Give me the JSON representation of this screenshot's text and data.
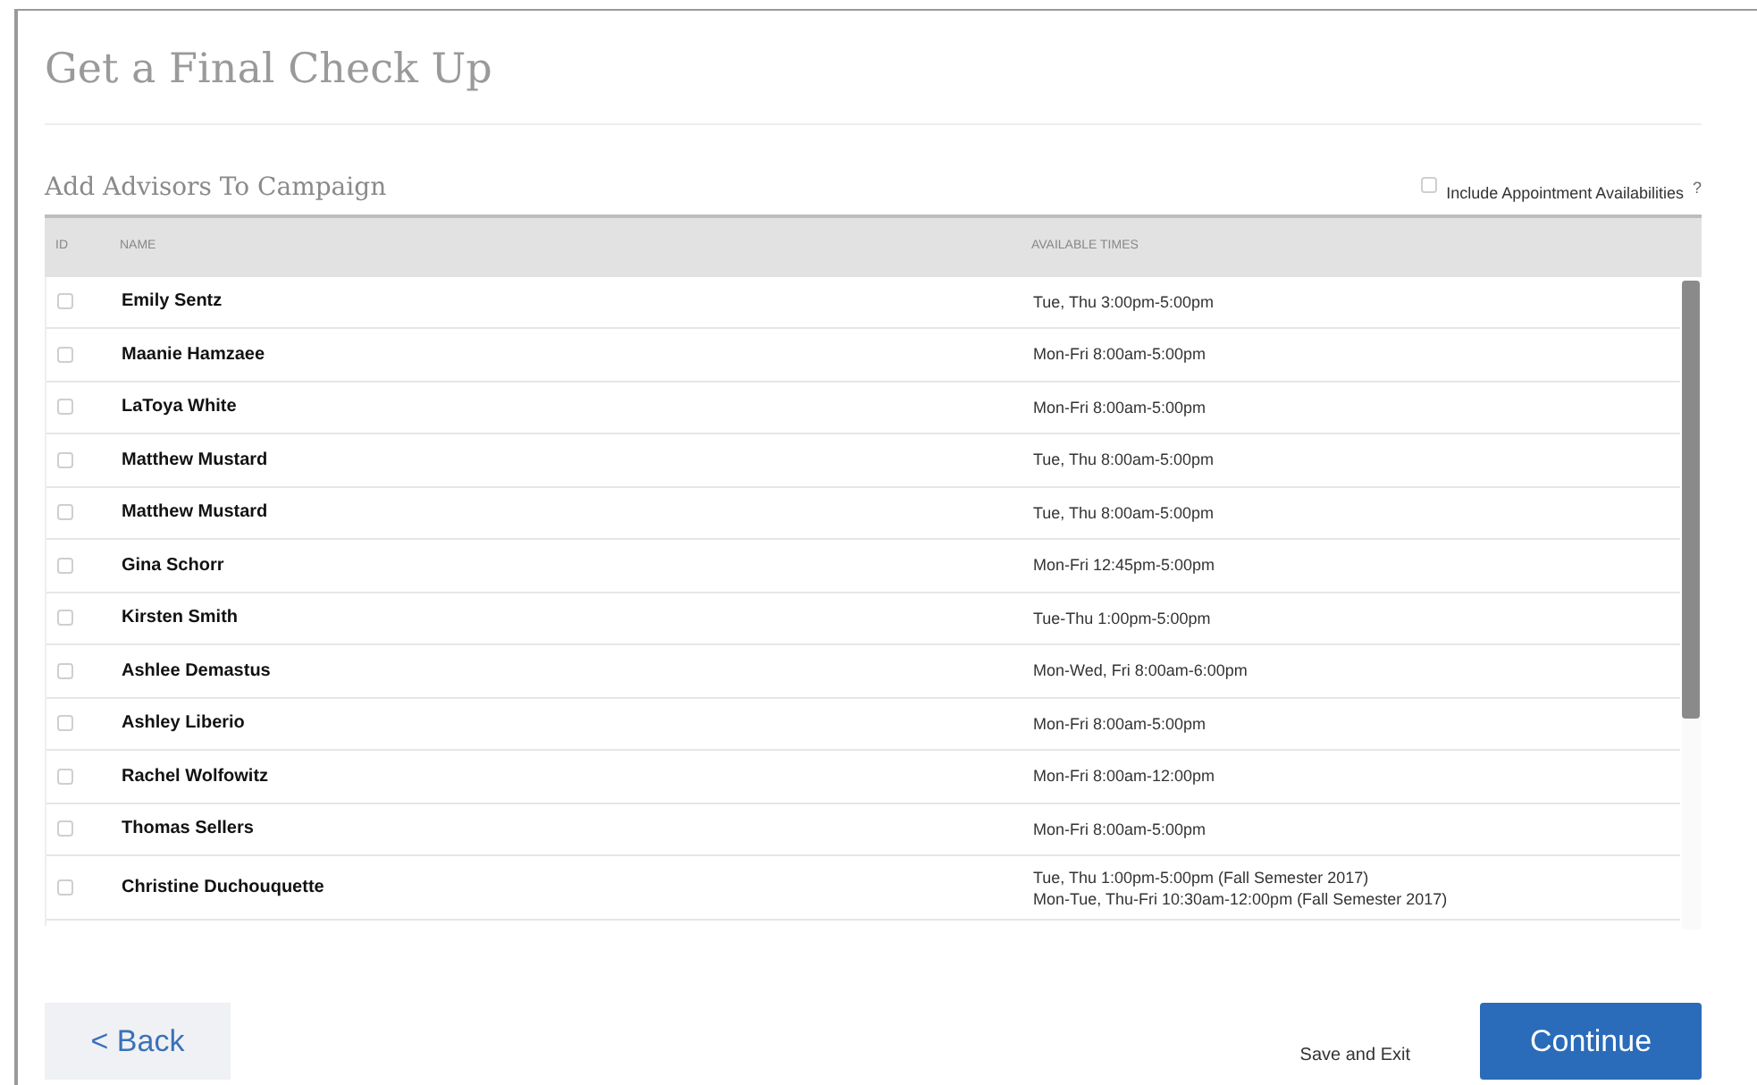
{
  "page": {
    "title": "Get a Final Check Up"
  },
  "section": {
    "title": "Add Advisors To Campaign",
    "include_option": {
      "label": "Include Appointment Availabilities",
      "help": "?",
      "checked": false
    }
  },
  "table": {
    "columns": [
      "ID",
      "NAME",
      "AVAILABLE TIMES"
    ],
    "rows": [
      {
        "checked": false,
        "name": "Emily Sentz",
        "times": [
          "Tue, Thu 3:00pm-5:00pm"
        ]
      },
      {
        "checked": false,
        "name": "Maanie Hamzaee",
        "times": [
          "Mon-Fri 8:00am-5:00pm"
        ]
      },
      {
        "checked": false,
        "name": "LaToya White",
        "times": [
          "Mon-Fri 8:00am-5:00pm"
        ]
      },
      {
        "checked": false,
        "name": "Matthew Mustard",
        "times": [
          "Tue, Thu 8:00am-5:00pm"
        ]
      },
      {
        "checked": false,
        "name": "Matthew Mustard",
        "times": [
          "Tue, Thu 8:00am-5:00pm"
        ]
      },
      {
        "checked": false,
        "name": "Gina Schorr",
        "times": [
          "Mon-Fri 12:45pm-5:00pm"
        ]
      },
      {
        "checked": false,
        "name": "Kirsten Smith",
        "times": [
          "Tue-Thu 1:00pm-5:00pm"
        ]
      },
      {
        "checked": false,
        "name": "Ashlee Demastus",
        "times": [
          "Mon-Wed, Fri 8:00am-6:00pm"
        ]
      },
      {
        "checked": false,
        "name": "Ashley Liberio",
        "times": [
          "Mon-Fri 8:00am-5:00pm"
        ]
      },
      {
        "checked": false,
        "name": "Rachel Wolfowitz",
        "times": [
          "Mon-Fri 8:00am-12:00pm"
        ]
      },
      {
        "checked": false,
        "name": "Thomas Sellers",
        "times": [
          "Mon-Fri 8:00am-5:00pm"
        ]
      },
      {
        "checked": false,
        "name": "Christine Duchouquette",
        "times": [
          "Tue, Thu 1:00pm-5:00pm (Fall Semester 2017)",
          "Mon-Tue, Thu-Fri 10:30am-12:00pm (Fall Semester 2017)"
        ]
      }
    ]
  },
  "actions": {
    "back": "< Back",
    "save_exit": "Save and Exit",
    "continue": "Continue"
  }
}
